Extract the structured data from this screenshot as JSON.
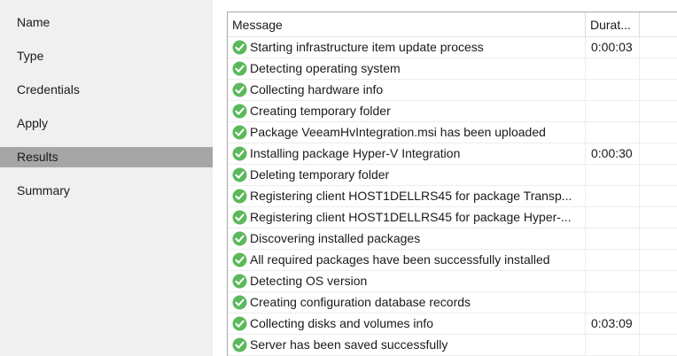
{
  "nav": {
    "items": [
      {
        "label": "Name",
        "active": false
      },
      {
        "label": "Type",
        "active": false
      },
      {
        "label": "Credentials",
        "active": false
      },
      {
        "label": "Apply",
        "active": false
      },
      {
        "label": "Results",
        "active": true
      },
      {
        "label": "Summary",
        "active": false
      }
    ]
  },
  "results": {
    "columns": {
      "message": "Message",
      "duration": "Durat..."
    },
    "status_icon": "success-check-icon",
    "status_color": "#5cb85c",
    "rows": [
      {
        "message": "Starting infrastructure item update process",
        "duration": "0:00:03"
      },
      {
        "message": "Detecting operating system",
        "duration": ""
      },
      {
        "message": "Collecting hardware info",
        "duration": ""
      },
      {
        "message": "Creating temporary folder",
        "duration": ""
      },
      {
        "message": "Package VeeamHvIntegration.msi has been uploaded",
        "duration": ""
      },
      {
        "message": "Installing package Hyper-V Integration",
        "duration": "0:00:30"
      },
      {
        "message": "Deleting temporary folder",
        "duration": ""
      },
      {
        "message": "Registering client HOST1DELLRS45 for package Transp...",
        "duration": ""
      },
      {
        "message": "Registering client HOST1DELLRS45 for package Hyper-...",
        "duration": ""
      },
      {
        "message": "Discovering installed packages",
        "duration": ""
      },
      {
        "message": "All required packages have been successfully installed",
        "duration": ""
      },
      {
        "message": "Detecting OS version",
        "duration": ""
      },
      {
        "message": "Creating configuration database records",
        "duration": ""
      },
      {
        "message": "Collecting disks and volumes info",
        "duration": "0:03:09"
      },
      {
        "message": "Server has been saved successfully",
        "duration": ""
      }
    ]
  }
}
